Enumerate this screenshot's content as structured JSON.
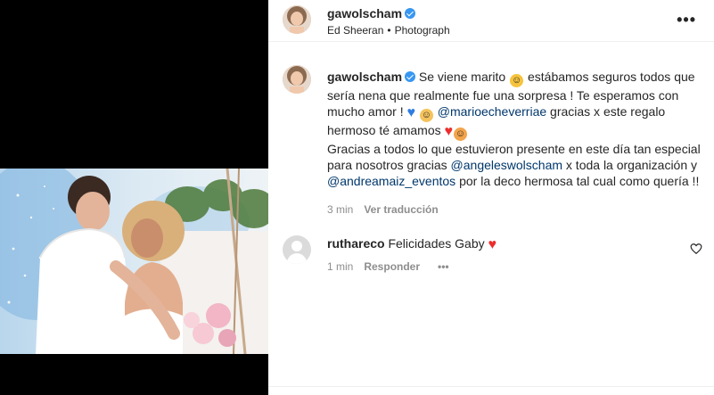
{
  "post": {
    "username": "gawolscham",
    "music": "Ed Sheeran",
    "separator": "•",
    "type": "Photograph",
    "more_label": "•••"
  },
  "caption": {
    "username": "gawolscham",
    "text_1": "Se viene marito",
    "text_2": "estábamos seguros todos que sería nena que realmente fue una sorpresa ! Te esperamos con mucho amor !",
    "mention_1": "@marioecheverriae",
    "text_3": "gracias x este regalo hermoso té amamos",
    "text_4": "Gracias a todos lo que estuvieron presente en este día tan especial para nosotros gracias",
    "mention_2": "@angeleswolscham",
    "text_5": "x toda la organización y",
    "mention_3": "@andreamaiz_eventos",
    "text_6": "por la deco hermosa tal cual como quería !!",
    "time": "3 min",
    "translate_label": "Ver traducción"
  },
  "comment": {
    "username": "rutharecol",
    "username_display": "ruthareco",
    "text": "Felicidades Gaby",
    "time": "1 min",
    "reply_label": "Responder",
    "more_label": "•••"
  },
  "colors": {
    "link": "#00376b",
    "verified": "#3897f0",
    "heart": "#ed2d2d",
    "muted": "#8e8e8e"
  }
}
